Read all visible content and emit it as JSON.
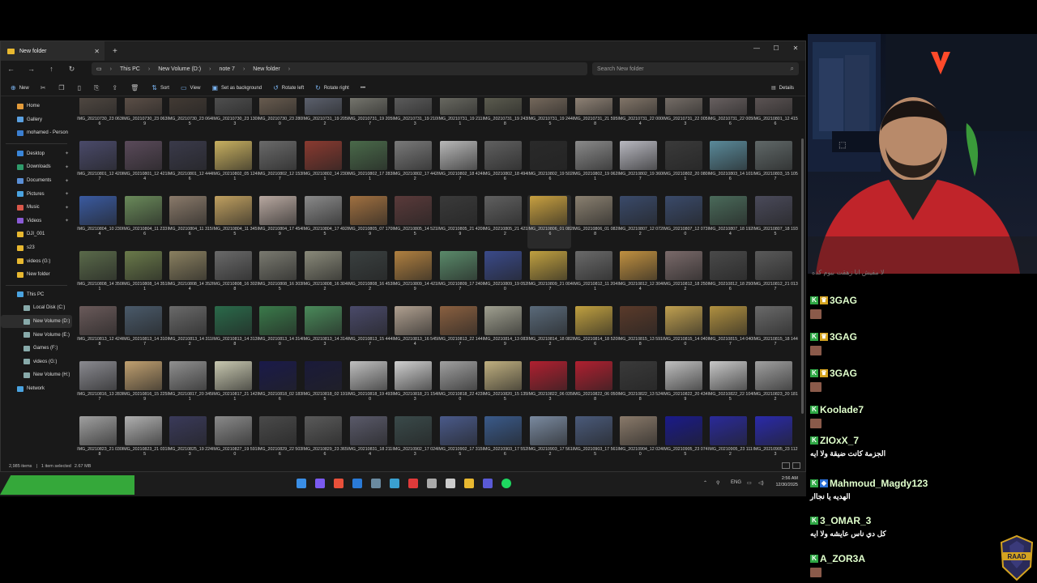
{
  "window": {
    "tab_title": "New folder",
    "new_tab": "+",
    "controls": {
      "minimize": "—",
      "maximize": "☐",
      "close": "✕"
    }
  },
  "address": {
    "back": "←",
    "forward": "→",
    "up": "↑",
    "refresh": "↻",
    "breadcrumbs": [
      "This PC",
      "New Volume (D:)",
      "note 7",
      "New folder"
    ],
    "search_placeholder": "Search New folder"
  },
  "command_bar": {
    "new": "New",
    "sort": "Sort",
    "view": "View",
    "set_background": "Set as background",
    "rotate_left": "Rotate left",
    "rotate_right": "Rotate right",
    "more": "•••",
    "details": "Details"
  },
  "nav_pane": {
    "quick": [
      {
        "label": "Home",
        "icon": "home-icon",
        "color": "#e39b3a"
      },
      {
        "label": "Gallery",
        "icon": "gallery-icon",
        "color": "#5aa0e0"
      },
      {
        "label": "mohamed - Person",
        "icon": "cloud-icon",
        "color": "#3b7fd0"
      }
    ],
    "pinned": [
      {
        "label": "Desktop",
        "icon": "desktop-icon",
        "color": "#3a86d9"
      },
      {
        "label": "Downloads",
        "icon": "downloads-icon",
        "color": "#2f9a6a"
      },
      {
        "label": "Documents",
        "icon": "documents-icon",
        "color": "#5a8fd6"
      },
      {
        "label": "Pictures",
        "icon": "pictures-icon",
        "color": "#4aa3e0"
      },
      {
        "label": "Music",
        "icon": "music-icon",
        "color": "#d9574a"
      },
      {
        "label": "Videos",
        "icon": "videos-icon",
        "color": "#8a5bd6"
      },
      {
        "label": "DJI_001",
        "icon": "folder-icon",
        "color": "#e8b830"
      },
      {
        "label": "s23",
        "icon": "folder-icon",
        "color": "#e8b830"
      },
      {
        "label": "videos (G:)",
        "icon": "folder-icon",
        "color": "#e8b830"
      },
      {
        "label": "New folder",
        "icon": "folder-icon",
        "color": "#e8b830"
      }
    ],
    "drives": [
      {
        "label": "This PC",
        "icon": "pc-icon",
        "color": "#4aa3e0"
      },
      {
        "label": "Local Disk (C:)",
        "icon": "drive-icon",
        "color": "#8aa"
      },
      {
        "label": "New Volume (D:)",
        "icon": "drive-icon",
        "color": "#8aa"
      },
      {
        "label": "New Volume (E:)",
        "icon": "drive-icon",
        "color": "#8aa"
      },
      {
        "label": "Games (F:)",
        "icon": "drive-icon",
        "color": "#8aa"
      },
      {
        "label": "videos (G:)",
        "icon": "drive-icon",
        "color": "#8aa"
      },
      {
        "label": "New Volume (H:)",
        "icon": "drive-icon",
        "color": "#8aa"
      },
      {
        "label": "Network",
        "icon": "network-icon",
        "color": "#4aa3e0"
      }
    ]
  },
  "files": [
    "IMG_20210730_23 0636",
    "IMG_20210730_23 0639",
    "IMG_20210730_23 0645",
    "IMG_20210730_23 1303",
    "IMG_20210730_23 2800",
    "IMG_20210731_19 2052",
    "IMG_20210731_19 2057",
    "IMG_20210731_19 2103",
    "IMG_20210731_19 2111",
    "IMG_20210731_19 2438",
    "IMG_20210731_19 2445",
    "IMG_20210731_21 5958",
    "IMG_20210731_22 0004",
    "IMG_20210731_22 0053",
    "IMG_20210731_22 0056",
    "IMG_20210801_12 4156",
    "IMG_20210801_12 4207",
    "IMG_20210801_12 4214",
    "IMG_20210801_12 4446",
    "IMG_20210802_05 1241",
    "IMG_20210802_12 1537",
    "IMG_20210802_14 2301",
    "IMG_20210802_17 2831",
    "IMG_20210802_17 4422",
    "IMG_20210802_18 4247",
    "IMG_20210802_18 4946",
    "IMG_20210802_19 5026",
    "IMG_20210802_19 0621",
    "IMG_20210802_19 3607",
    "IMG_20210802_20 0801",
    "IMG_20210803_14 1016",
    "IMG_20210803_15 1057",
    "IMG_20210804_10 2304",
    "IMG_20210804_11 2336",
    "IMG_20210804_11 3156",
    "IMG_20210804_11 3455",
    "IMG_20210804_17 4549",
    "IMG_20210804_17 4925",
    "IMG_20210805_07 1709",
    "IMG_20210805_14 5215",
    "IMG_20210805_21 4209",
    "IMG_20210805_21 4212",
    "IMG_20210806_01 0826",
    "IMG_20210806_01 0828",
    "IMG_20210807_12 0722",
    "IMG_20210807_12 0730",
    "IMG_20210807_18 1924",
    "IMG_20210807_18 1935",
    "IMG_20210808_14 3501",
    "IMG_20210808_14 3511",
    "IMG_20210808_14 3524",
    "IMG_20210808_16 3028",
    "IMG_20210808_16 3035",
    "IMG_20210808_16 3042",
    "IMG_20210808_16 4532",
    "IMG_20210809_14 4219",
    "IMG_20210809_17 2407",
    "IMG_20210809_19 0520",
    "IMG_20210809_21 0047",
    "IMG_20210812_11 2041",
    "IMG_20210812_12 3044",
    "IMG_20210812_18 2502",
    "IMG_20210812_18 2506",
    "IMG_20210812_21 0137",
    "IMG_20210813_12 4248",
    "IMG_20210813_14 3107",
    "IMG_20210813_14 3112",
    "IMG_20210813_14 3138",
    "IMG_20210813_14 3140",
    "IMG_20210813_14 3143",
    "IMG_20210813_15 4447",
    "IMG_20210813_16 5454",
    "IMG_20210813_22 1447",
    "IMG_20210814_13 0839",
    "IMG_20210814_18 0822",
    "IMG_20210814_18 5206",
    "IMG_20210815_13 5918",
    "IMG_20210815_14 0400",
    "IMG_20210815_14 0407",
    "IMG_20210815_18 1447",
    "IMG_20210816_13 2837",
    "IMG_20210816_15 2259",
    "IMG_20210817_20 3451",
    "IMG_20210817_21 1421",
    "IMG_20210818_02 1836",
    "IMG_20210818_02 1915",
    "IMG_20210818_19 4930",
    "IMG_20210818_21 1543",
    "IMG_20210818_22 4230",
    "IMG_20210820_15 1355",
    "IMG_20210822_06 0353",
    "IMG_20210822_06 0508",
    "IMG_20210822_13 5248",
    "IMG_20210822_20 4349",
    "IMG_20210822_22 1045",
    "IMG_20210823_20 1812",
    "IMG_20210823_21 0308",
    "IMG_20210823_21 0315",
    "IMG_20210825_19 2243",
    "IMG_20210827_19 5910",
    "IMG_20210829_22 5036",
    "IMG_20210829_23 3656",
    "IMG_20210831_18 2114",
    "IMG_20210902_17 0243",
    "IMG_20210902_17 3155",
    "IMG_20210903_17 5526",
    "IMG_20210903_17 5612",
    "IMG_20210903_17 5615",
    "IMG_20210904_12 0240",
    "IMG_20210905_23 0745",
    "IMG_20210905_23 1112",
    "IMG_20210905_23 1123"
  ],
  "thumb_colors": [
    "#5a5048",
    "#6a5a50",
    "#4a4038",
    "#5a5a5a",
    "#7a6a5a",
    "#6a7080",
    "#8a8a80",
    "#6a6a6a",
    "#7a7a70",
    "#6a6a5a",
    "#8a7a6a",
    "#aa9a8a",
    "#9a8a7a",
    "#8a8078",
    "#7a7070",
    "#6a6060",
    "#4a4a6a",
    "#5a4a5a",
    "#3a3a4a",
    "#c8b060",
    "#6a6a6a",
    "#8a3a30",
    "#4a6a4a",
    "#7a7a7a",
    "#b8b8b8",
    "#606060",
    "#2a2a2a",
    "#8a8a8a",
    "#b8b8c0",
    "#3a3a3a",
    "#5a8a9a",
    "#606868",
    "#3a5aa0",
    "#6a8a5a",
    "#8a7a6a",
    "#c0a060",
    "#b8a8a0",
    "#8a8a8a",
    "#a07040",
    "#5a3a3a",
    "#3a3a3a",
    "#606060",
    "#c8a040",
    "#8a8070",
    "#3a4a6a",
    "#3a4a6a",
    "#4a6a5a",
    "#4a4a5a",
    "#5a6a4a",
    "#6a7a4a",
    "#8a8060",
    "#6a6a6a",
    "#7a7a70",
    "#8a8a7a",
    "#3a4040",
    "#b08040",
    "#5a8a6a",
    "#3a4a8a",
    "#c0a040",
    "#6a6a6a",
    "#c09040",
    "#7a6a6a",
    "#4a4a4a",
    "#5a5a5a",
    "#6a5a5a",
    "#4a5a6a",
    "#6a6a6a",
    "#2a6a4a",
    "#3a7a4a",
    "#4a8a5a",
    "#4a4a6a",
    "#b0a090",
    "#8a6040",
    "#a0a090",
    "#5a6a7a",
    "#c0a040",
    "#5a3a2a",
    "#c0a050",
    "#b09040",
    "#6a6a6a",
    "#8a8a90",
    "#c0a070",
    "#909090",
    "#c8c8b0",
    "#1a1a4a",
    "#1a1a3a",
    "#c0c0c0",
    "#d0d0d0",
    "#a0a0a0",
    "#c0b080",
    "#b02030",
    "#b02030",
    "#3a3a3a",
    "#c0c0c0",
    "#c8c8c8",
    "#a0a0a0",
    "#a0a0a0",
    "#b0b0b0",
    "#3a3a5a",
    "#8a8a8a",
    "#4a4a4a",
    "#5a5a5a",
    "#5a5a6a",
    "#3a4a4a",
    "#4a5a8a",
    "#3a5a8a",
    "#7a8aa0",
    "#4a5a7a",
    "#8a7a6a",
    "#1a1a8a",
    "#2a2a9a",
    "#2a2aaa"
  ],
  "status": {
    "count": "2,985 items",
    "selected": "1 item selected",
    "size": "2.67 MB"
  },
  "taskbar": {
    "icons": [
      "windows-icon",
      "copilot-icon",
      "chrome-icon",
      "mail-icon",
      "app-icon",
      "edge-icon",
      "record-icon",
      "app-icon-2",
      "app-icon-3",
      "folder-icon",
      "teams-icon",
      "spotify-icon"
    ],
    "lang": "ENG",
    "time": "2:56 AM",
    "date": "12/30/2025"
  },
  "chat": [
    {
      "user": "3GAG",
      "badge": "crown"
    },
    {
      "user": "3GAG",
      "badge": "crown"
    },
    {
      "user": "3GAG",
      "badge": "crown"
    },
    {
      "user": "Koolade7",
      "badge": "none"
    },
    {
      "user": "ZIOxX_7",
      "badge": "none",
      "message": "الجزمة كانت ضيقة ولا ايه"
    },
    {
      "user": "Mahmoud_Magdy123",
      "badge": "blue",
      "message": "الهديه يا نجاار"
    },
    {
      "user": "3_OMAR_3",
      "badge": "none",
      "message": "كل دي ناس عايشه ولا ايه"
    },
    {
      "user": "A_ZOR3A",
      "badge": "none"
    }
  ],
  "overlay_text": "لا مفيش انا زهقت بيوم كده",
  "logo_text": "RAAD"
}
